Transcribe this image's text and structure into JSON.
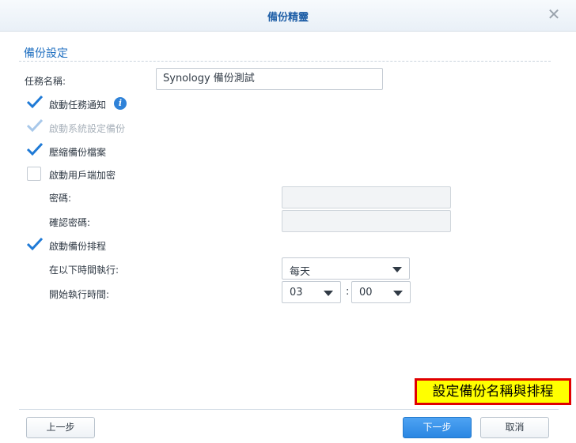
{
  "window": {
    "title": "備份精靈",
    "close_icon": "close-icon"
  },
  "section": {
    "title": "備份設定"
  },
  "task_name": {
    "label": "任務名稱:",
    "value": "Synology 備份測試"
  },
  "options": {
    "notify": {
      "label": "啟動任務通知",
      "checked": true
    },
    "system_config": {
      "label": "啟動系統設定備份",
      "checked": true,
      "disabled": true
    },
    "compress": {
      "label": "壓縮備份檔案",
      "checked": true
    },
    "encrypt": {
      "label": "啟動用戶端加密",
      "checked": false
    }
  },
  "password": {
    "label": "密碼:",
    "value": ""
  },
  "confirm_password": {
    "label": "確認密碼:",
    "value": ""
  },
  "schedule": {
    "label": "啟動備份排程",
    "checked": true,
    "run_at_label": "在以下時間執行:",
    "run_at_value": "每天",
    "start_time_label": "開始執行時間:",
    "hour": "03",
    "minute": "00",
    "separator": ":"
  },
  "buttons": {
    "back": "上一步",
    "next": "下一步",
    "cancel": "取消"
  },
  "annotation": {
    "text": "設定備份名稱與排程"
  },
  "colors": {
    "accent": "#2a86e2",
    "check": "#1f7ad6",
    "check_disabled": "#a8c8ea",
    "annotation_bg": "#ffff00",
    "annotation_border": "#e00000"
  }
}
